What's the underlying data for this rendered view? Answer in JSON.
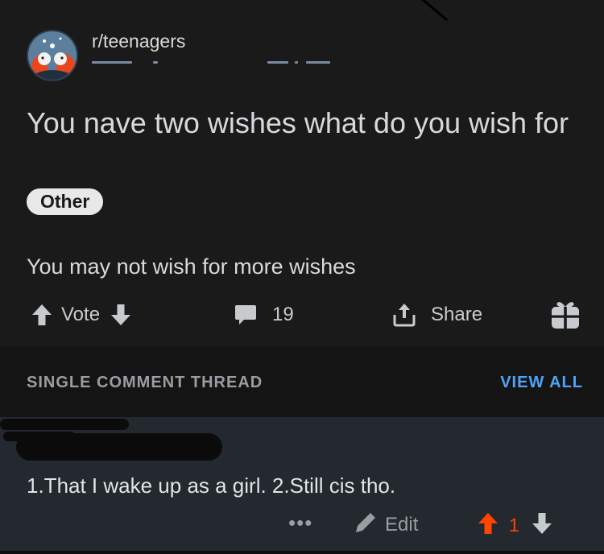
{
  "post": {
    "subreddit": "r/teenagers",
    "title": "You nave two wishes what do you wish for",
    "flair": "Other",
    "body": "You may not wish for more wishes",
    "actions": {
      "vote_label": "Vote",
      "comment_count": "19",
      "share_label": "Share"
    }
  },
  "thread": {
    "label": "SINGLE COMMENT THREAD",
    "view_all": "VIEW ALL"
  },
  "comment": {
    "text": "1.That I wake up as a girl. 2.Still cis tho.",
    "more": "•••",
    "edit_label": "Edit",
    "score": "1"
  },
  "colors": {
    "background": "#1a1a1b",
    "upvote_active": "#ff4500",
    "link": "#4fa3f7",
    "flair_bg": "#e8e8e8",
    "comment_bg": "#23292f"
  },
  "icons": [
    "subreddit-avatar",
    "upvote-icon",
    "downvote-icon",
    "comment-icon",
    "share-icon",
    "gift-icon",
    "more-icon",
    "pencil-icon"
  ]
}
